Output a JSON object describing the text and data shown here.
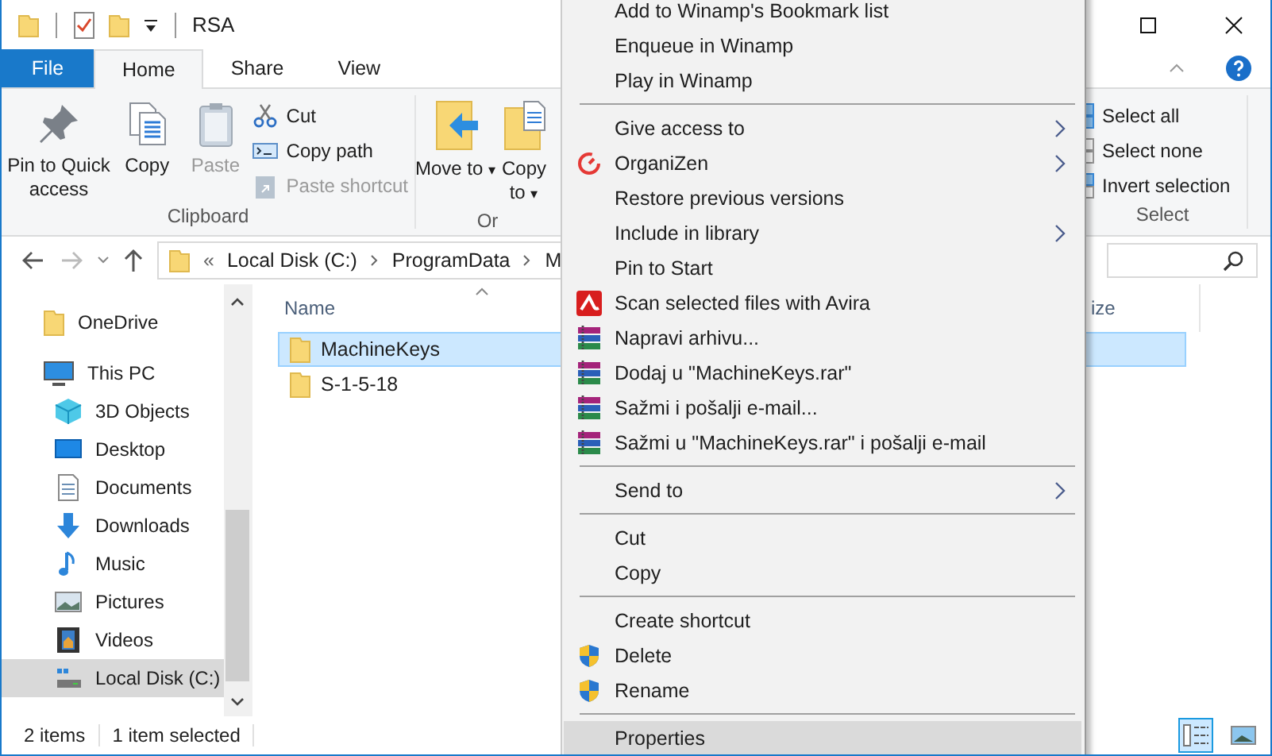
{
  "window": {
    "title": "RSA"
  },
  "ribbon_tabs": [
    {
      "label": "File",
      "kind": "file",
      "selected": false
    },
    {
      "label": "Home",
      "kind": "tab",
      "selected": true
    },
    {
      "label": "Share",
      "kind": "tab",
      "selected": false
    },
    {
      "label": "View",
      "kind": "tab",
      "selected": false
    }
  ],
  "clipboard": {
    "large_buttons": [
      {
        "label": "Pin to Quick access",
        "disabled": false
      },
      {
        "label": "Copy",
        "disabled": false
      },
      {
        "label": "Paste",
        "disabled": true
      }
    ],
    "small_buttons": [
      {
        "label": "Cut",
        "disabled": false
      },
      {
        "label": "Copy path",
        "disabled": false
      },
      {
        "label": "Paste shortcut",
        "disabled": true
      }
    ],
    "group_label": "Clipboard"
  },
  "organize": {
    "large_buttons": [
      {
        "label": "Move to",
        "caret": "▾"
      },
      {
        "label": "Copy to",
        "caret": "▾"
      }
    ],
    "group_label": "Or"
  },
  "select": {
    "buttons": [
      {
        "label": "Select all"
      },
      {
        "label": "Select none"
      },
      {
        "label": "Invert selection"
      }
    ],
    "group_label": "Select"
  },
  "address": {
    "overflow": "«",
    "segments": [
      "Local Disk (C:)",
      "ProgramData",
      "M"
    ]
  },
  "nav": [
    {
      "label": "OneDrive",
      "selected": false
    },
    {
      "label": "This PC",
      "selected": false,
      "children": [
        {
          "label": "3D Objects",
          "selected": false
        },
        {
          "label": "Desktop",
          "selected": false
        },
        {
          "label": "Documents",
          "selected": false
        },
        {
          "label": "Downloads",
          "selected": false
        },
        {
          "label": "Music",
          "selected": false
        },
        {
          "label": "Pictures",
          "selected": false
        },
        {
          "label": "Videos",
          "selected": false
        },
        {
          "label": "Local Disk (C:)",
          "selected": true
        }
      ]
    }
  ],
  "columns": [
    "Name",
    "ize"
  ],
  "files": [
    {
      "name": "MachineKeys",
      "selected": true
    },
    {
      "name": "S-1-5-18",
      "selected": false
    }
  ],
  "status_bar": {
    "items": "2 items",
    "selection": "1 item selected"
  },
  "view_buttons": [
    {
      "kind": "details",
      "selected": true
    },
    {
      "kind": "large-icons",
      "selected": false
    }
  ],
  "context_menu": [
    {
      "kind": "item",
      "label": "Add to Winamp's Bookmark list",
      "submenu": false,
      "selected": false
    },
    {
      "kind": "item",
      "label": "Enqueue in Winamp",
      "submenu": false,
      "selected": false
    },
    {
      "kind": "item",
      "label": "Play in Winamp",
      "submenu": false,
      "selected": false
    },
    {
      "kind": "separator"
    },
    {
      "kind": "item",
      "label": "Give access to",
      "submenu": true,
      "selected": false
    },
    {
      "kind": "item",
      "label": "OrganiZen",
      "submenu": true,
      "selected": false
    },
    {
      "kind": "item",
      "label": "Restore previous versions",
      "submenu": false,
      "selected": false
    },
    {
      "kind": "item",
      "label": "Include in library",
      "submenu": true,
      "selected": false
    },
    {
      "kind": "item",
      "label": "Pin to Start",
      "submenu": false,
      "selected": false
    },
    {
      "kind": "item",
      "label": "Scan selected files with Avira",
      "submenu": false,
      "selected": false
    },
    {
      "kind": "item",
      "label": "Napravi arhivu...",
      "submenu": false,
      "selected": false
    },
    {
      "kind": "item",
      "label": "Dodaj u \"MachineKeys.rar\"",
      "submenu": false,
      "selected": false
    },
    {
      "kind": "item",
      "label": "Sažmi i pošalji e-mail...",
      "submenu": false,
      "selected": false
    },
    {
      "kind": "item",
      "label": "Sažmi u \"MachineKeys.rar\" i pošalji e-mail",
      "submenu": false,
      "selected": false
    },
    {
      "kind": "separator"
    },
    {
      "kind": "item",
      "label": "Send to",
      "submenu": true,
      "selected": false
    },
    {
      "kind": "separator"
    },
    {
      "kind": "item",
      "label": "Cut",
      "submenu": false,
      "selected": false
    },
    {
      "kind": "item",
      "label": "Copy",
      "submenu": false,
      "selected": false
    },
    {
      "kind": "separator"
    },
    {
      "kind": "item",
      "label": "Create shortcut",
      "submenu": false,
      "selected": false
    },
    {
      "kind": "item",
      "label": "Delete",
      "submenu": false,
      "selected": false
    },
    {
      "kind": "item",
      "label": "Rename",
      "submenu": false,
      "selected": false
    },
    {
      "kind": "separator"
    },
    {
      "kind": "item",
      "label": "Properties",
      "submenu": false,
      "selected": true
    }
  ]
}
